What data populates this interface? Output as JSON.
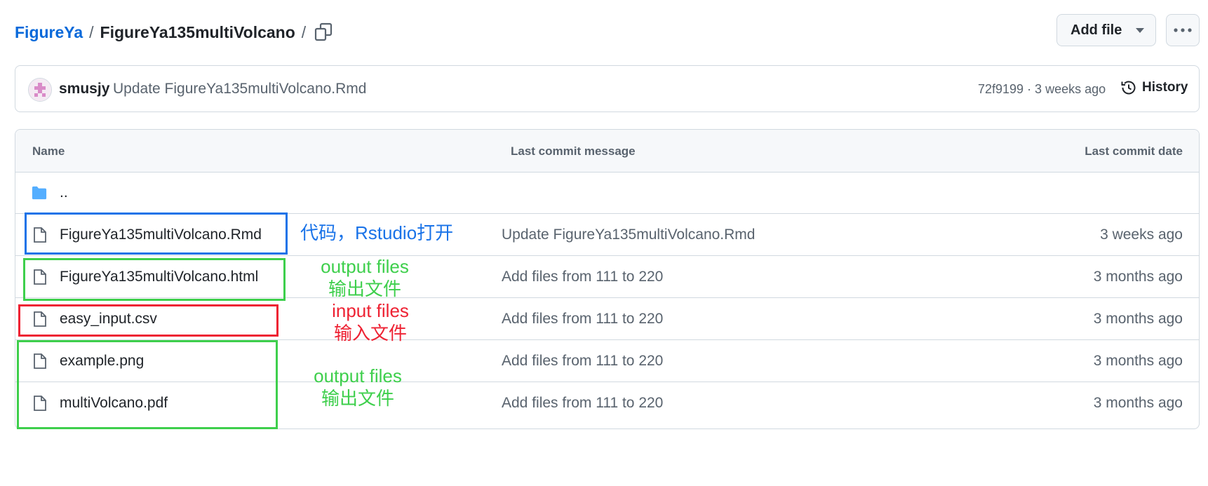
{
  "breadcrumb": {
    "repo": "FigureYa",
    "separator1": "/",
    "folder": "FigureYa135multiVolcano",
    "separator2": "/"
  },
  "toolbar": {
    "add_file_label": "Add file"
  },
  "commit": {
    "author": "smusjy",
    "message": "Update FigureYa135multiVolcano.Rmd",
    "meta": "72f9199 · 3 weeks ago",
    "history_label": "History"
  },
  "table": {
    "headers": {
      "name": "Name",
      "message": "Last commit message",
      "date": "Last commit date"
    },
    "parent_dir": "..",
    "rows": [
      {
        "name": "FigureYa135multiVolcano.Rmd",
        "message": "Update FigureYa135multiVolcano.Rmd",
        "date": "3 weeks ago"
      },
      {
        "name": "FigureYa135multiVolcano.html",
        "message": "Add files from 111 to 220",
        "date": "3 months ago"
      },
      {
        "name": "easy_input.csv",
        "message": "Add files from 111 to 220",
        "date": "3 months ago"
      },
      {
        "name": "example.png",
        "message": "Add files from 111 to 220",
        "date": "3 months ago"
      },
      {
        "name": "multiVolcano.pdf",
        "message": "Add files from 111 to 220",
        "date": "3 months ago"
      }
    ]
  },
  "annotations": {
    "code": "代码，Rstudio打开",
    "output1_en": "output files",
    "output1_zh": "输出文件",
    "input_en": "input files",
    "input_zh": "输入文件",
    "output2_en": "output files",
    "output2_zh": "输出文件"
  },
  "colors": {
    "link": "#0969da",
    "annotation_blue": "#1a73e8",
    "annotation_green": "#3ecf4c",
    "annotation_red": "#ee2233",
    "folder_icon": "#54aeff"
  },
  "icons": [
    "copy-icon",
    "dropdown-caret-icon",
    "kebab-icon",
    "avatar-icon",
    "history-icon",
    "folder-icon",
    "file-icon"
  ]
}
